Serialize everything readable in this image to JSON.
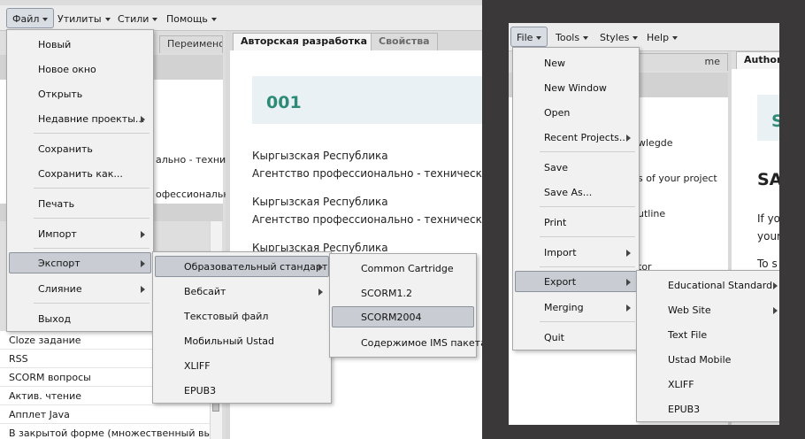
{
  "left": {
    "menubar": [
      {
        "label": "Файл"
      },
      {
        "label": "Утилиты"
      },
      {
        "label": "Стили"
      },
      {
        "label": "Помощь"
      }
    ],
    "tab_left_partial": "Переименов",
    "tabs": [
      {
        "label": "Авторская разработка"
      },
      {
        "label": "Свойства"
      }
    ],
    "tree_fragments": [
      "ально - технич",
      "офессионально"
    ],
    "content": {
      "title": "001",
      "paragraphs": [
        {
          "line1": "Кыргызская Республика",
          "line2": "Агентство профессионально - технического"
        },
        {
          "line1": "Кыргызская Республика",
          "line2": "Агентство профессионально - технического"
        },
        {
          "line1": "Кыргызская Республика"
        }
      ]
    },
    "idevice_list": [
      "Cloze задание",
      "RSS",
      "SCORM вопросы",
      "Актив. чтение",
      "Апплет Java",
      "В закрытой форме (множественный выб..."
    ],
    "file_menu": [
      {
        "label": "Новый"
      },
      {
        "label": "Новое окно"
      },
      {
        "label": "Открыть"
      },
      {
        "label": "Недавние проекты..."
      },
      {
        "label": "Сохранить"
      },
      {
        "label": "Сохранить как..."
      },
      {
        "label": "Печать"
      },
      {
        "label": "Импорт"
      },
      {
        "label": "Экспорт"
      },
      {
        "label": "Слияние"
      },
      {
        "label": "Выход"
      }
    ],
    "export_menu": [
      {
        "label": "Образовательный стандарт"
      },
      {
        "label": "Вебсайт"
      },
      {
        "label": "Текстовый файл"
      },
      {
        "label": "Мобильный Ustad"
      },
      {
        "label": "XLIFF"
      },
      {
        "label": "EPUB3"
      }
    ],
    "standard_menu": [
      {
        "label": "Common Cartridge"
      },
      {
        "label": "SCORM1.2"
      },
      {
        "label": "SCORM2004"
      },
      {
        "label": "Содержимое IMS пакета"
      }
    ]
  },
  "right": {
    "menubar": [
      {
        "label": "File"
      },
      {
        "label": "Tools"
      },
      {
        "label": "Styles"
      },
      {
        "label": "Help"
      }
    ],
    "tab_partial": "Author",
    "tab_left_partial": "me",
    "tree_fragments": [
      "wlegde",
      "s of your project",
      "utline",
      "tor"
    ],
    "content": {
      "title_partial": "S",
      "heading_partial": "SA",
      "lines": [
        "If yo",
        "your",
        "To s"
      ]
    },
    "file_menu": [
      {
        "label": "New"
      },
      {
        "label": "New Window"
      },
      {
        "label": "Open"
      },
      {
        "label": "Recent Projects..."
      },
      {
        "label": "Save"
      },
      {
        "label": "Save As..."
      },
      {
        "label": "Print"
      },
      {
        "label": "Import"
      },
      {
        "label": "Export"
      },
      {
        "label": "Merging"
      },
      {
        "label": "Quit"
      }
    ],
    "export_menu": [
      {
        "label": "Educational Standard"
      },
      {
        "label": "Web Site"
      },
      {
        "label": "Text File"
      },
      {
        "label": "Ustad Mobile"
      },
      {
        "label": "XLIFF"
      },
      {
        "label": "EPUB3"
      }
    ]
  },
  "colors": {
    "desktop": "#3a3839",
    "menu_bg": "#f1f1f1",
    "highlight": "#c9cdd3",
    "title_accent": "#2d8a76",
    "content_band": "#e9f1f4"
  }
}
